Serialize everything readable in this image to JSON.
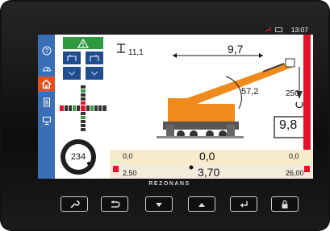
{
  "status": {
    "time": "13:07",
    "wrench_icon": "wrench-icon",
    "battery_icon": "battery-icon"
  },
  "colors": {
    "nav": "#3a6fb5",
    "active_nav": "#e2501e",
    "warning": "#2e9a3d",
    "crane": "#ef8a1c",
    "alert": "#e0152a"
  },
  "nav": {
    "items": [
      "help-icon",
      "speedometer-icon",
      "home-icon",
      "document-icon",
      "monitor-icon"
    ],
    "active": "home-icon"
  },
  "side_panel": {
    "warning_icon": "warning-triangle-icon",
    "gauge_value": "234"
  },
  "crane": {
    "height_label": "11,1",
    "radius_value": "9,7",
    "angle_value": "57,2",
    "hook_load_value": "250",
    "load_value": "9,8"
  },
  "strip": {
    "top_left": "0,0",
    "top_center": "0,0",
    "top_right": "0,0",
    "bottom_left": "2,50",
    "bottom_center": "3,70",
    "bottom_right": "26,00"
  },
  "brand": "REZONANS",
  "keys": [
    "wrench-icon",
    "back-icon",
    "arrow-down-icon",
    "arrow-up-icon",
    "enter-icon",
    "lock-icon"
  ]
}
